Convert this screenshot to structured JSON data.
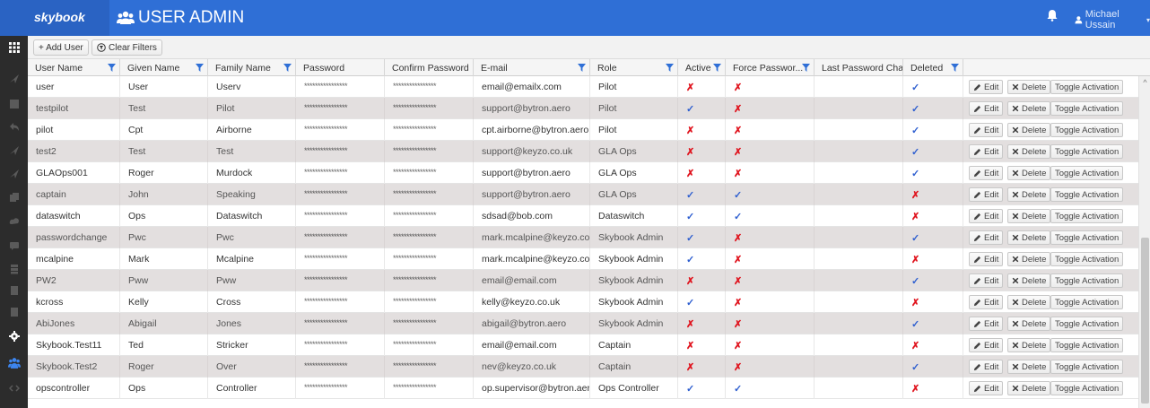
{
  "header": {
    "brand": "skybook",
    "title": "USER ADMIN",
    "user_name": "Michael Ussain",
    "user_caret": "▾"
  },
  "toolbar": {
    "add_user_label": "+ Add User",
    "clear_filters_label": "Clear Filters"
  },
  "columns": [
    {
      "label": "User Name",
      "filter": true
    },
    {
      "label": "Given Name",
      "filter": true
    },
    {
      "label": "Family Name",
      "filter": true
    },
    {
      "label": "Password",
      "filter": false
    },
    {
      "label": "Confirm Password",
      "filter": false
    },
    {
      "label": "E-mail",
      "filter": true
    },
    {
      "label": "Role",
      "filter": true
    },
    {
      "label": "Active",
      "filter": true
    },
    {
      "label": "Force Passwor...",
      "filter": true
    },
    {
      "label": "Last Password Cha...",
      "filter": false
    },
    {
      "label": "Deleted",
      "filter": true
    },
    {
      "label": "",
      "filter": false
    }
  ],
  "actions": {
    "edit_label": "Edit",
    "delete_label": "Delete",
    "toggle_label": "Toggle Activation"
  },
  "masked_password": "****************",
  "check_glyph": "✓",
  "cross_glyph": "✗",
  "rows": [
    {
      "user_name": "user",
      "given_name": "User",
      "family_name": "Userv",
      "email": "email@emailx.com",
      "role": "Pilot",
      "active": false,
      "force": false,
      "last_change": "",
      "deleted": true
    },
    {
      "user_name": "testpilot",
      "given_name": "Test",
      "family_name": "Pilot",
      "email": "support@bytron.aero",
      "role": "Pilot",
      "active": true,
      "force": false,
      "last_change": "",
      "deleted": true
    },
    {
      "user_name": "pilot",
      "given_name": "Cpt",
      "family_name": "Airborne",
      "email": "cpt.airborne@bytron.aero",
      "role": "Pilot",
      "active": false,
      "force": false,
      "last_change": "",
      "deleted": true
    },
    {
      "user_name": "test2",
      "given_name": "Test",
      "family_name": "Test",
      "email": "support@keyzo.co.uk",
      "role": "GLA Ops",
      "active": false,
      "force": false,
      "last_change": "",
      "deleted": true
    },
    {
      "user_name": "GLAOps001",
      "given_name": "Roger",
      "family_name": "Murdock",
      "email": "support@bytron.aero",
      "role": "GLA Ops",
      "active": false,
      "force": false,
      "last_change": "",
      "deleted": true
    },
    {
      "user_name": "captain",
      "given_name": "John",
      "family_name": "Speaking",
      "email": "support@bytron.aero",
      "role": "GLA Ops",
      "active": true,
      "force": true,
      "last_change": "",
      "deleted": false
    },
    {
      "user_name": "dataswitch",
      "given_name": "Ops",
      "family_name": "Dataswitch",
      "email": "sdsad@bob.com",
      "role": "Dataswitch",
      "active": true,
      "force": true,
      "last_change": "",
      "deleted": false
    },
    {
      "user_name": "passwordchange",
      "given_name": "Pwc",
      "family_name": "Pwc",
      "email": "mark.mcalpine@keyzo.co.uk",
      "role": "Skybook Admin",
      "active": true,
      "force": false,
      "last_change": "",
      "deleted": true
    },
    {
      "user_name": "mcalpine",
      "given_name": "Mark",
      "family_name": "Mcalpine",
      "email": "mark.mcalpine@keyzo.co.uk",
      "role": "Skybook Admin",
      "active": true,
      "force": false,
      "last_change": "",
      "deleted": false
    },
    {
      "user_name": "PW2",
      "given_name": "Pww",
      "family_name": "Pww",
      "email": "email@email.com",
      "role": "Skybook Admin",
      "active": false,
      "force": false,
      "last_change": "",
      "deleted": true
    },
    {
      "user_name": "kcross",
      "given_name": "Kelly",
      "family_name": "Cross",
      "email": "kelly@keyzo.co.uk",
      "role": "Skybook Admin",
      "active": true,
      "force": false,
      "last_change": "",
      "deleted": false
    },
    {
      "user_name": "AbiJones",
      "given_name": "Abigail",
      "family_name": "Jones",
      "email": "abigail@bytron.aero",
      "role": "Skybook Admin",
      "active": false,
      "force": false,
      "last_change": "",
      "deleted": true
    },
    {
      "user_name": "Skybook.Test11",
      "given_name": "Ted",
      "family_name": "Stricker",
      "email": "email@email.com",
      "role": "Captain",
      "active": false,
      "force": false,
      "last_change": "",
      "deleted": false
    },
    {
      "user_name": "Skybook.Test2",
      "given_name": "Roger",
      "family_name": "Over",
      "email": "nev@keyzo.co.uk",
      "role": "Captain",
      "active": false,
      "force": false,
      "last_change": "",
      "deleted": true
    },
    {
      "user_name": "opscontroller",
      "given_name": "Ops",
      "family_name": "Controller",
      "email": "op.supervisor@bytron.aero",
      "role": "Ops Controller",
      "active": true,
      "force": true,
      "last_change": "",
      "deleted": false
    }
  ],
  "sidebar_icons": [
    "grid-icon",
    "plane-icon",
    "book-icon",
    "return-icon",
    "send-icon",
    "plane-icon",
    "files-icon",
    "weather-icon",
    "chat-icon",
    "database-icon",
    "document-icon",
    "document-icon",
    "gear-icon",
    "users-icon",
    "code-icon"
  ],
  "colors": {
    "header_blue": "#2f6fd6",
    "check_blue": "#2f5fd0",
    "cross_red": "#e0141e",
    "alt_row": "#e3dfdf",
    "sidebar": "#2c2c2c"
  }
}
